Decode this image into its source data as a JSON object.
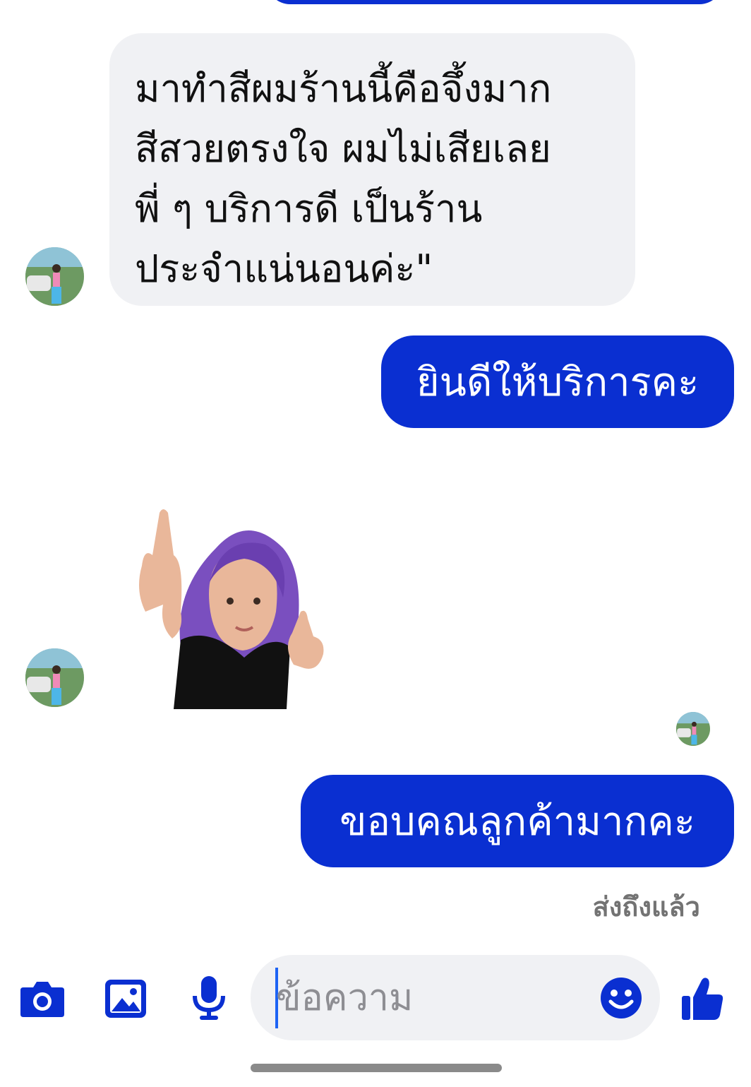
{
  "conversation": {
    "incoming_text": {
      "lines": [
        "มาทำสีผมร้านนี้คือจึ้งมาก",
        "สีสวยตรงใจ ผมไม่เสียเลย",
        "พี่ ๆ บริการดี เป็นร้าน",
        "ประจำแน่นอนค่ะ\""
      ]
    },
    "reply_1": "ยินดีให้บริการคะ",
    "reply_2": "ขอบคณลูกค้ามากคะ",
    "delivery_status": "ส่งถึงแล้ว"
  },
  "composer": {
    "placeholder": "ข้อความ",
    "icons": [
      "camera-icon",
      "gallery-icon",
      "microphone-icon",
      "emoji-icon",
      "thumbs-up-icon"
    ]
  },
  "colors": {
    "accent": "#0a2fd1",
    "incoming_bubble": "#f0f1f4",
    "status_text": "#737373"
  }
}
